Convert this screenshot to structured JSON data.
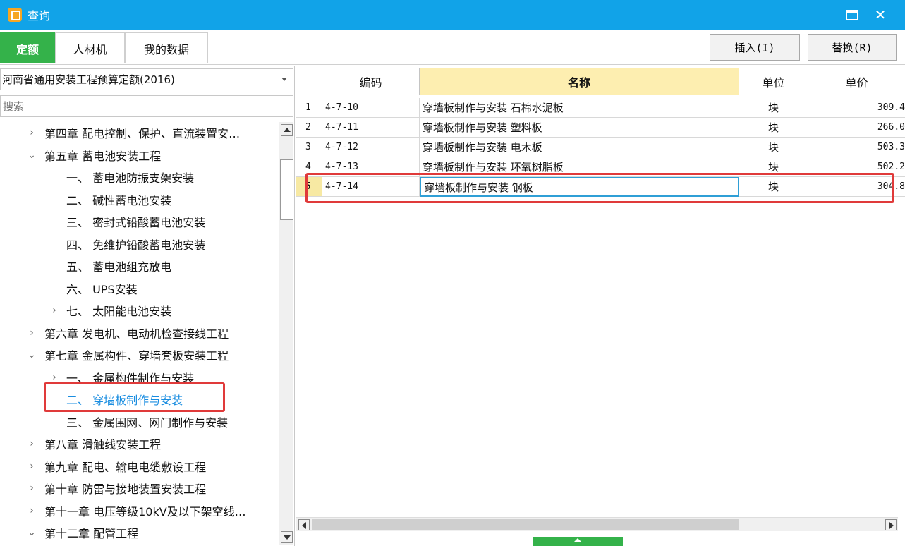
{
  "window": {
    "title": "查询"
  },
  "tabs": [
    {
      "label": "定额",
      "active": true
    },
    {
      "label": "人材机",
      "active": false
    },
    {
      "label": "我的数据",
      "active": false
    }
  ],
  "actions": {
    "insert_label": "插入(I)",
    "replace_label": "替换(R)"
  },
  "left_panel": {
    "library": "河南省通用安装工程预算定额(2016)",
    "search_placeholder": "搜索",
    "tree": [
      {
        "arrow": "›",
        "label": "第四章 配电控制、保护、直流装置安…",
        "level": 0,
        "selected": false
      },
      {
        "arrow": "⌄",
        "label": "第五章 蓄电池安装工程",
        "level": 0,
        "selected": false
      },
      {
        "arrow": "",
        "label": "一、 蓄电池防振支架安装",
        "level": 1,
        "selected": false
      },
      {
        "arrow": "",
        "label": "二、 碱性蓄电池安装",
        "level": 1,
        "selected": false
      },
      {
        "arrow": "",
        "label": "三、 密封式铅酸蓄电池安装",
        "level": 1,
        "selected": false
      },
      {
        "arrow": "",
        "label": "四、 免维护铅酸蓄电池安装",
        "level": 1,
        "selected": false
      },
      {
        "arrow": "",
        "label": "五、 蓄电池组充放电",
        "level": 1,
        "selected": false
      },
      {
        "arrow": "",
        "label": "六、 UPS安装",
        "level": 1,
        "selected": false
      },
      {
        "arrow": "›",
        "label": "七、 太阳能电池安装",
        "level": 1,
        "selected": false
      },
      {
        "arrow": "›",
        "label": "第六章 发电机、电动机检查接线工程",
        "level": 0,
        "selected": false
      },
      {
        "arrow": "⌄",
        "label": "第七章 金属构件、穿墙套板安装工程",
        "level": 0,
        "selected": false
      },
      {
        "arrow": "›",
        "label": "一、 金属构件制作与安装",
        "level": 1,
        "selected": false
      },
      {
        "arrow": "",
        "label": "二、 穿墙板制作与安装",
        "level": 1,
        "selected": true
      },
      {
        "arrow": "",
        "label": "三、 金属围网、网门制作与安装",
        "level": 1,
        "selected": false
      },
      {
        "arrow": "›",
        "label": "第八章 滑触线安装工程",
        "level": 0,
        "selected": false
      },
      {
        "arrow": "›",
        "label": "第九章 配电、输电电缆敷设工程",
        "level": 0,
        "selected": false
      },
      {
        "arrow": "›",
        "label": "第十章 防雷与接地装置安装工程",
        "level": 0,
        "selected": false
      },
      {
        "arrow": "›",
        "label": "第十一章 电压等级10kV及以下架空线…",
        "level": 0,
        "selected": false
      },
      {
        "arrow": "⌄",
        "label": "第十二章 配管工程",
        "level": 0,
        "selected": false
      }
    ]
  },
  "grid": {
    "columns": [
      "",
      "编码",
      "名称",
      "单位",
      "单价"
    ],
    "rows": [
      {
        "idx": "1",
        "code": "4-7-10",
        "name": "穿墙板制作与安装 石棉水泥板",
        "unit": "块",
        "price": "309.4"
      },
      {
        "idx": "2",
        "code": "4-7-11",
        "name": "穿墙板制作与安装 塑料板",
        "unit": "块",
        "price": "266.0"
      },
      {
        "idx": "3",
        "code": "4-7-12",
        "name": "穿墙板制作与安装 电木板",
        "unit": "块",
        "price": "503.3"
      },
      {
        "idx": "4",
        "code": "4-7-13",
        "name": "穿墙板制作与安装 环氧树脂板",
        "unit": "块",
        "price": "502.2"
      },
      {
        "idx": "5",
        "code": "4-7-14",
        "name": "穿墙板制作与安装 钢板",
        "unit": "块",
        "price": "304.8",
        "selected": true
      }
    ]
  },
  "colors": {
    "title_bar": "#11a3e8",
    "accent_green": "#34b24a",
    "highlight": "#e03a3a",
    "selection_blue": "#1a8de0"
  }
}
